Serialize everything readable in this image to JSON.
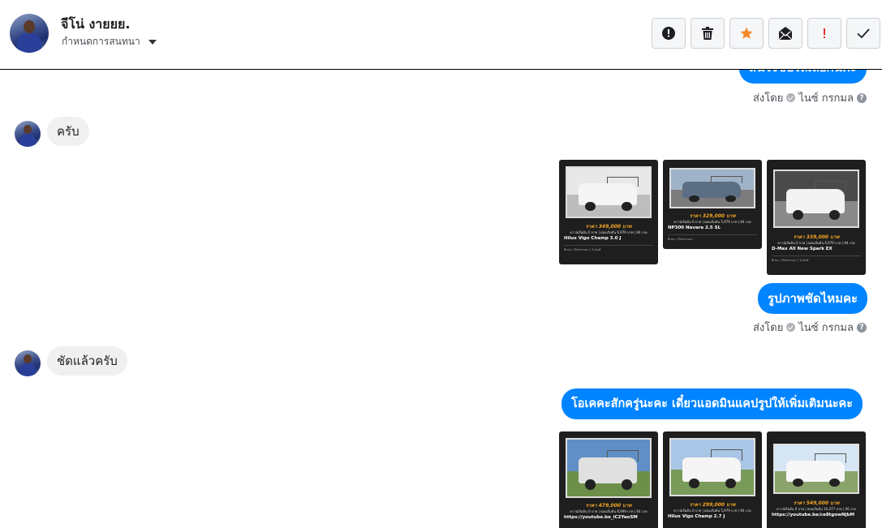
{
  "header": {
    "contact_name": "จีโน่ งายยย.",
    "label_dropdown": "กำหนดการสนทนา",
    "toolbar": [
      {
        "name": "mark-spam-button",
        "icon": "alert-circle-icon"
      },
      {
        "name": "delete-button",
        "icon": "trash-icon"
      },
      {
        "name": "star-button",
        "icon": "star-icon",
        "color": "#f5882a"
      },
      {
        "name": "mark-unread-button",
        "icon": "envelope-icon"
      },
      {
        "name": "follow-up-button",
        "icon": "exclamation-icon",
        "color": "#e0322c"
      },
      {
        "name": "mark-done-button",
        "icon": "check-icon"
      }
    ]
  },
  "messages": {
    "partial_out_text": "สนใจขับรถเลยกันค่ะ",
    "sent_by_label": "ส่งโดย",
    "sent_by_name": "ไนซ์ กรกมล",
    "help": "?",
    "in_1": "ครับ",
    "out_1": "รูปภาพชัดไหมคะ",
    "in_2": "ชัดแล้วครับ",
    "out_2": "โอเคคะสักครู่นะคะ เดี๋ยวแอดมินแคปรูปให้เพิ่มเติมนะคะ"
  },
  "car_cards_row1": [
    {
      "price": "ราคา 349,000 บาท",
      "line": "ดาวน์เริ่มต้น 0 บาท | ผ่อนเริ่มต้น 6,979 บาท | 84 งวด",
      "model": "Hilux Vigo Champ 3.0 J",
      "specs": "ดีเซล | เกียร์ธรรมดา | ไมล์แท้"
    },
    {
      "price": "ราคา 329,000 บาท",
      "line": "ดาวน์เริ่มต้น 0 บาท | ผ่อนเริ่มต้น 5,979 บาท | 84 งวด",
      "model": "NP300 Navara 2.5 SL",
      "specs": "ดีเซล | เกียร์ธรรมดา"
    },
    {
      "price": "ราคา 339,000 บาท",
      "line": "ดาวน์เริ่มต้น 0 บาท | ผ่อนเริ่มต้น 6,979 บาท | 84 งวด",
      "model": "D-Max All New Spark EX",
      "specs": "ดีเซล | เกียร์ธรรมดา | ไมล์แท้"
    }
  ],
  "car_cards_row2": [
    {
      "price": "ราคา 479,000 บาท",
      "line": "ดาวน์เริ่มต้น 0 บาท | ผ่อนเริ่มต้น 8,999 บาท | 84 งวด",
      "model": "https://youtube.be_iC2YaoSM"
    },
    {
      "price": "ราคา 299,000 บาท",
      "line": "ดาวน์เริ่มต้น 0 บาท | ผ่อนเริ่มต้น 5,979 บาท | 84 งวด",
      "model": "Hilux Vigo Champ 2.7 J"
    },
    {
      "price": "ราคา 549,000 บาท",
      "line": "ดาวน์เริ่มต้น 0 บาท | ผ่อนเริ่มต้น 10,477 บาท | 96 งวด",
      "model": "https://youtube.be/ce8tgowNjbM"
    }
  ],
  "colors": {
    "accent": "#0084ff",
    "incoming_bubble": "#f1f0f0",
    "card_bg": "#1e1e1e",
    "price": "#f5a623"
  }
}
